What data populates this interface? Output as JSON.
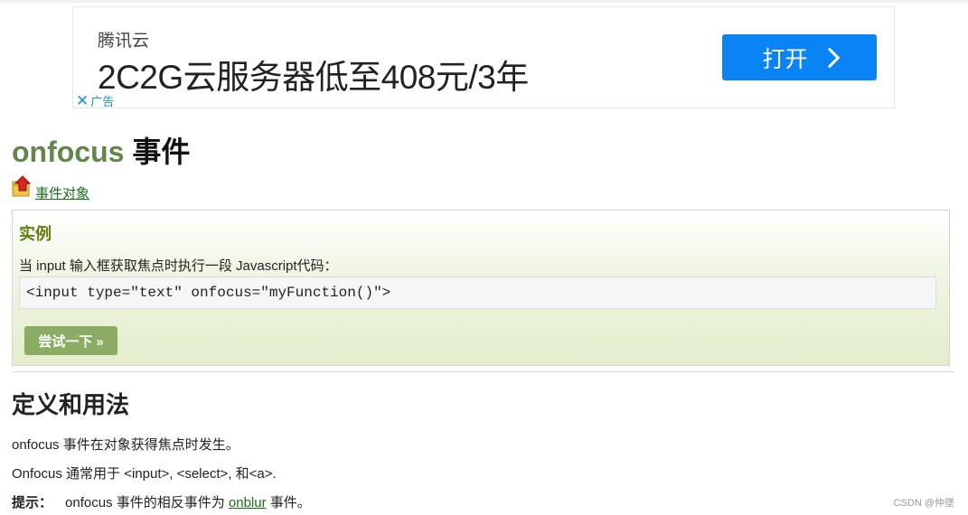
{
  "ad": {
    "brand": "腾讯云",
    "headline": "2C2G云服务器低至408元/3年",
    "button_label": "打开",
    "close_label": "广告",
    "close_symbol": "✕",
    "button_color": "#0a84f4"
  },
  "page": {
    "title_accent": "onfocus",
    "title_rest": " 事件",
    "back_link": "事件对象"
  },
  "example": {
    "heading": "实例",
    "description": "当 input 输入框获取焦点时执行一段 Javascript代码：",
    "code": "<input type=\"text\" onfocus=\"myFunction()\">",
    "try_button": "尝试一下 »"
  },
  "definition": {
    "heading": "定义和用法",
    "p1": "onfocus 事件在对象获得焦点时发生。",
    "p2": "Onfocus 通常用于 <input>, <select>, 和<a>.",
    "tip_label": "提示：",
    "tip_before": "onfocus 事件的相反事件为 ",
    "tip_link": "onblur",
    "tip_after": " 事件。"
  },
  "watermark": "CSDN @仲墜",
  "colors": {
    "title_accent": "#64854c",
    "example_heading": "#617f10",
    "try_button": "#8aac63",
    "link": "#1a6f1a"
  }
}
